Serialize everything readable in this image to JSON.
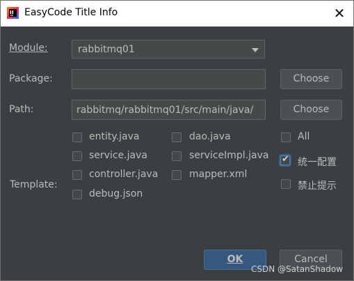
{
  "window": {
    "title": "EasyCode Title Info",
    "close_icon": "close-icon"
  },
  "form": {
    "module_label": "Module:",
    "module_value": "rabbitmq01",
    "package_label": "Package:",
    "package_value": "",
    "path_label": "Path:",
    "path_value": "/rabbitmq/rabbitmq01/src/main/java",
    "choose_label": "Choose",
    "template_label": "Template:"
  },
  "templates": [
    {
      "label": "entity.java",
      "checked": false
    },
    {
      "label": "dao.java",
      "checked": false
    },
    {
      "label": "service.java",
      "checked": false
    },
    {
      "label": "serviceImpl.java",
      "checked": false
    },
    {
      "label": "controller.java",
      "checked": false
    },
    {
      "label": "mapper.xml",
      "checked": false
    },
    {
      "label": "debug.json",
      "checked": false
    }
  ],
  "options": [
    {
      "label": "All",
      "checked": false
    },
    {
      "label": "统一配置",
      "checked": true
    },
    {
      "label": "禁止提示",
      "checked": false
    }
  ],
  "buttons": {
    "ok": "OK",
    "cancel": "Cancel"
  },
  "watermark": "CSDN @SatanShadow",
  "colors": {
    "background": "#3c3f41",
    "ok_button": "#365880",
    "field": "#45494a"
  }
}
